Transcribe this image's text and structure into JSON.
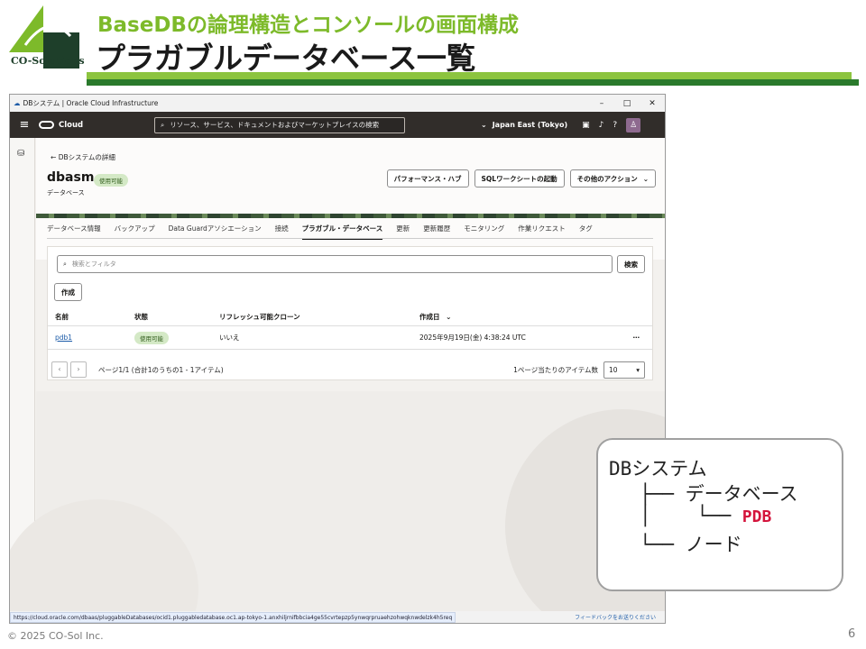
{
  "slide": {
    "logo_text": "CO-Solutions",
    "subtitle": "BaseDBの論理構造とコンソールの画面構成",
    "title": "プラガブルデータベース一覧",
    "copyright": "© 2025 CO-Sol Inc.",
    "page_number": "6"
  },
  "browser": {
    "window_title": "DBシステム | Oracle Cloud Infrastructure",
    "status_url": "https://cloud.oracle.com/dbaas/pluggableDatabases/ocid1.pluggabledatabase.oc1.ap-tokyo-1.anxhiljrnifbbcia4ge55cvrtepzp5ynwqrpruaehzohwqknwdelzk4h5req",
    "feedback_label": "フィードバックをお送りください"
  },
  "oci_header": {
    "brand": "Cloud",
    "search_placeholder": "リソース、サービス、ドキュメントおよびマーケットプレイスの検索",
    "region": "Japan East (Tokyo)"
  },
  "page": {
    "back_link": "DBシステムの詳細",
    "db_name": "dbasm",
    "db_status": "使用可能",
    "db_type": "データベース",
    "actions": [
      "パフォーマンス・ハブ",
      "SQLワークシートの起動",
      "その他のアクション"
    ],
    "tabs": [
      "データベース情報",
      "バックアップ",
      "Data Guardアソシエーション",
      "接続",
      "プラガブル・データベース",
      "更新",
      "更新履歴",
      "モニタリング",
      "作業リクエスト",
      "タグ"
    ],
    "active_tab": "プラガブル・データベース"
  },
  "pdb_list": {
    "filter_placeholder": "検索とフィルタ",
    "search_button": "検索",
    "create_button": "作成",
    "columns": [
      "名前",
      "状態",
      "リフレッシュ可能クローン",
      "作成日"
    ],
    "rows": [
      {
        "name": "pdb1",
        "status": "使用可能",
        "refreshable_clone": "いいえ",
        "created": "2025年9月19日(金) 4:38:24 UTC"
      }
    ],
    "pager_text": "ページ1/1 (合計1のうちの1 - 1アイテム)",
    "per_page_label": "1ページ当たりのアイテム数",
    "per_page_value": "10"
  },
  "hierarchy": {
    "root": "DBシステム",
    "database": "データベース",
    "pdb": "PDB",
    "node": "ノード",
    "colors": {
      "pdb": "#d4143c"
    }
  }
}
